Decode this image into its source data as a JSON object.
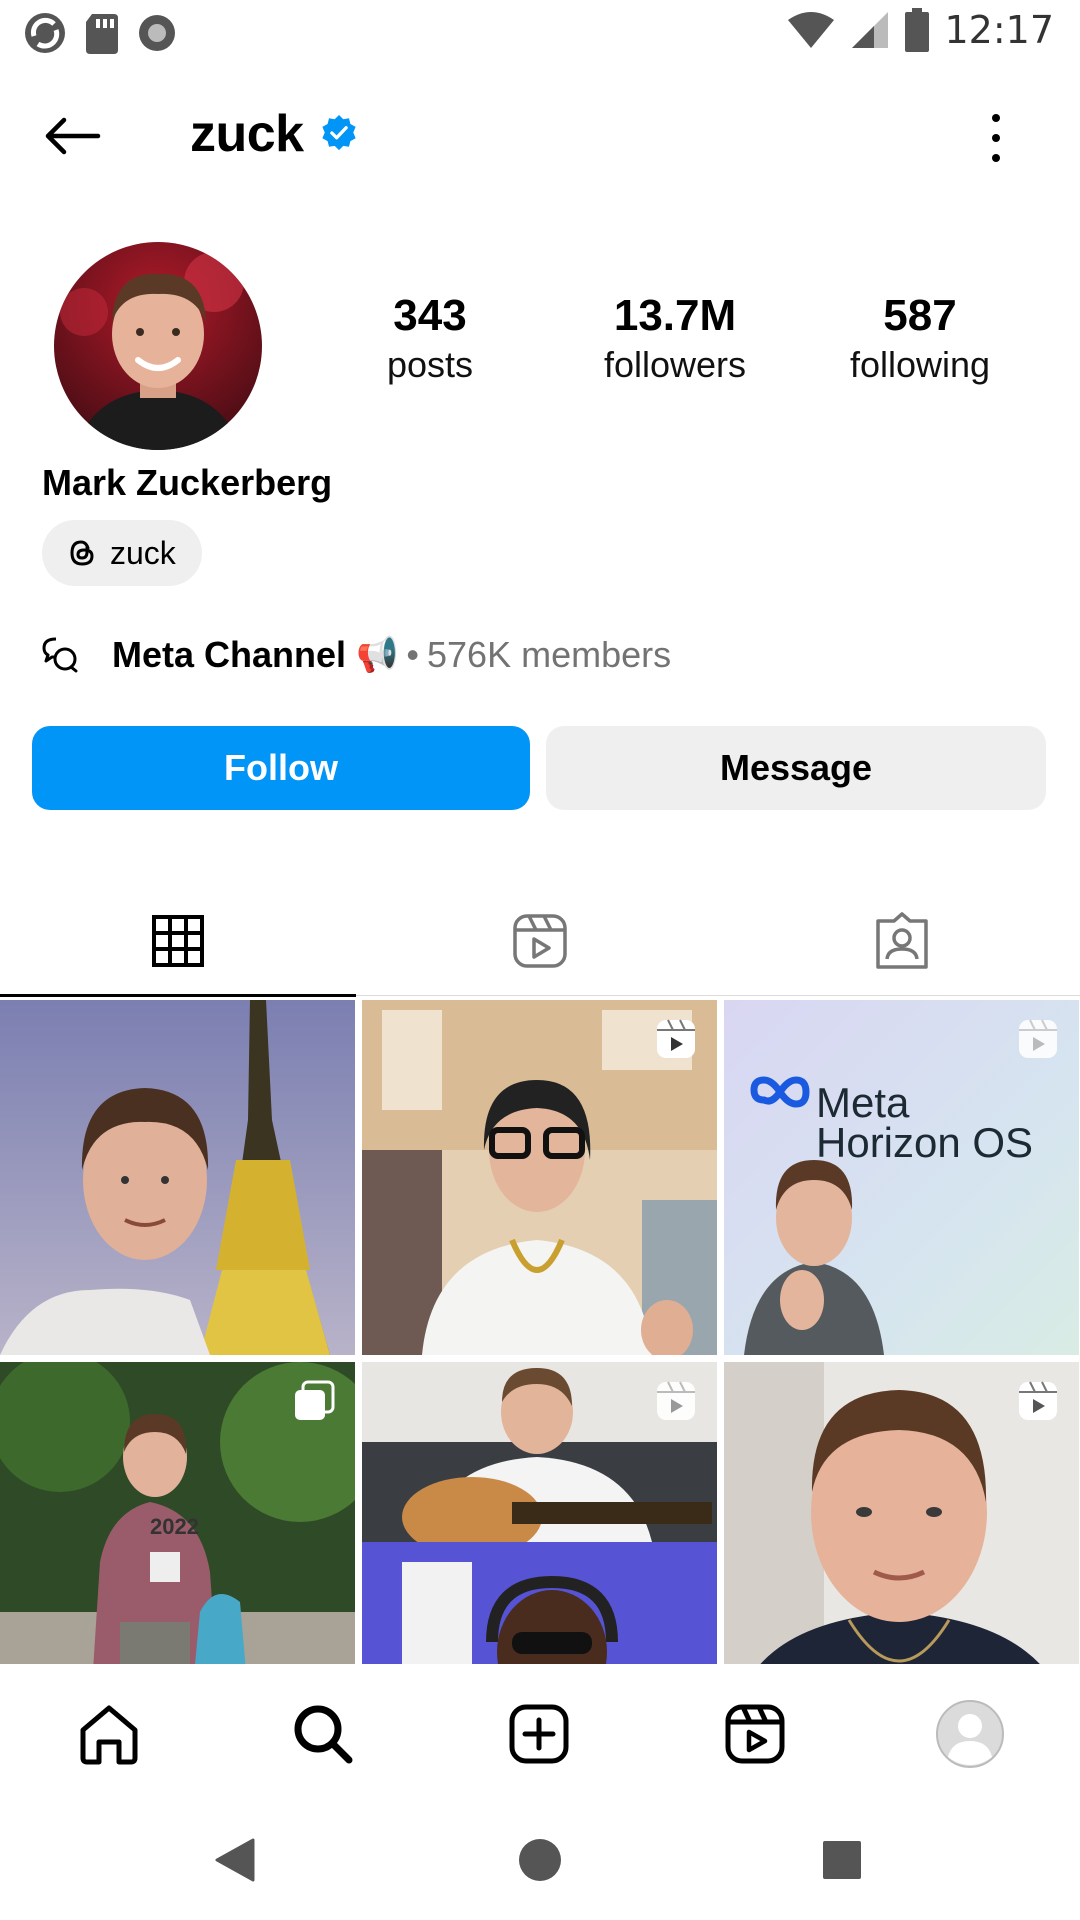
{
  "status_bar": {
    "time": "12:17",
    "icons": [
      "sync-icon",
      "sd-card-icon",
      "record-icon",
      "wifi-icon",
      "signal-icon",
      "battery-icon"
    ]
  },
  "header": {
    "username": "zuck",
    "verified": true,
    "back_icon": "arrow-left-icon",
    "more_icon": "more-vertical-icon"
  },
  "profile": {
    "full_name": "Mark Zuckerberg",
    "threads_handle": "zuck",
    "stats": [
      {
        "value": "343",
        "label": "posts"
      },
      {
        "value": "13.7M",
        "label": "followers"
      },
      {
        "value": "587",
        "label": "following"
      }
    ],
    "channel": {
      "name": "Meta Channel",
      "emoji": "📢",
      "separator": "•",
      "members": "576K members"
    }
  },
  "actions": {
    "follow_label": "Follow",
    "message_label": "Message"
  },
  "tabs": [
    {
      "name": "grid",
      "icon": "grid-icon",
      "active": true
    },
    {
      "name": "reels",
      "icon": "reels-icon",
      "active": false
    },
    {
      "name": "tagged",
      "icon": "tagged-icon",
      "active": false
    }
  ],
  "grid_posts": [
    {
      "type": "photo"
    },
    {
      "type": "reel"
    },
    {
      "type": "reel",
      "overlay_text_1": "Meta",
      "overlay_text_2": "Horizon OS"
    },
    {
      "type": "carousel",
      "bib_text": "2022"
    },
    {
      "type": "reel"
    },
    {
      "type": "reel"
    }
  ],
  "bottom_nav": [
    "home-icon",
    "search-icon",
    "create-icon",
    "reels-icon",
    "profile-icon"
  ],
  "colors": {
    "accent": "#0095f6",
    "secondary_button": "#efefef",
    "muted_text": "#737373",
    "verified": "#0095f6"
  }
}
